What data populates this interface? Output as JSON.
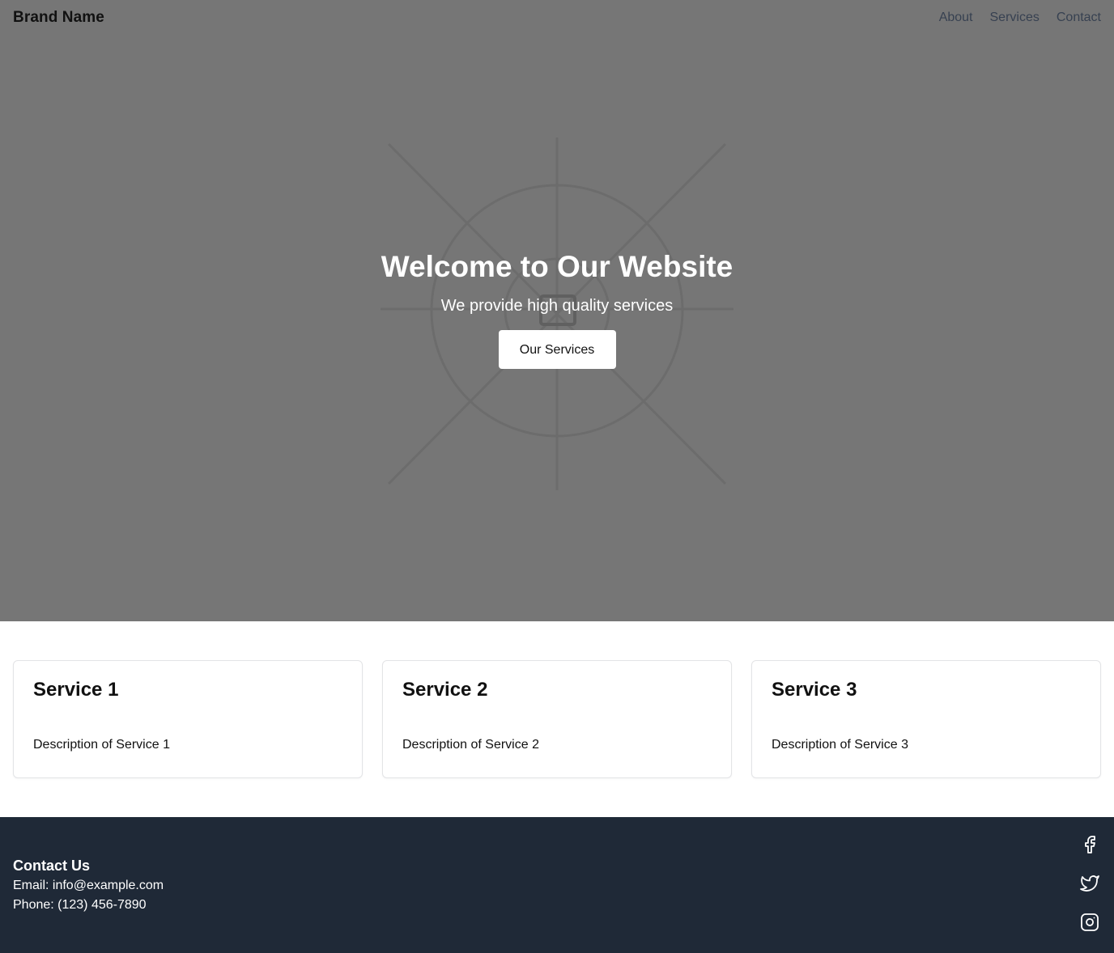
{
  "header": {
    "brand": "Brand Name",
    "nav": [
      "About",
      "Services",
      "Contact"
    ]
  },
  "hero": {
    "title": "Welcome to Our Website",
    "subtitle": "We provide high quality services",
    "button_label": "Our Services",
    "background_color": "#767676"
  },
  "services": [
    {
      "title": "Service 1",
      "description": "Description of Service 1"
    },
    {
      "title": "Service 2",
      "description": "Description of Service 2"
    },
    {
      "title": "Service 3",
      "description": "Description of Service 3"
    }
  ],
  "footer": {
    "contact_title": "Contact Us",
    "email_line": "Email: info@example.com",
    "phone_line": "Phone: (123) 456-7890",
    "background_color": "#1f2937",
    "social_icons": [
      "facebook-icon",
      "twitter-icon",
      "instagram-icon"
    ]
  }
}
